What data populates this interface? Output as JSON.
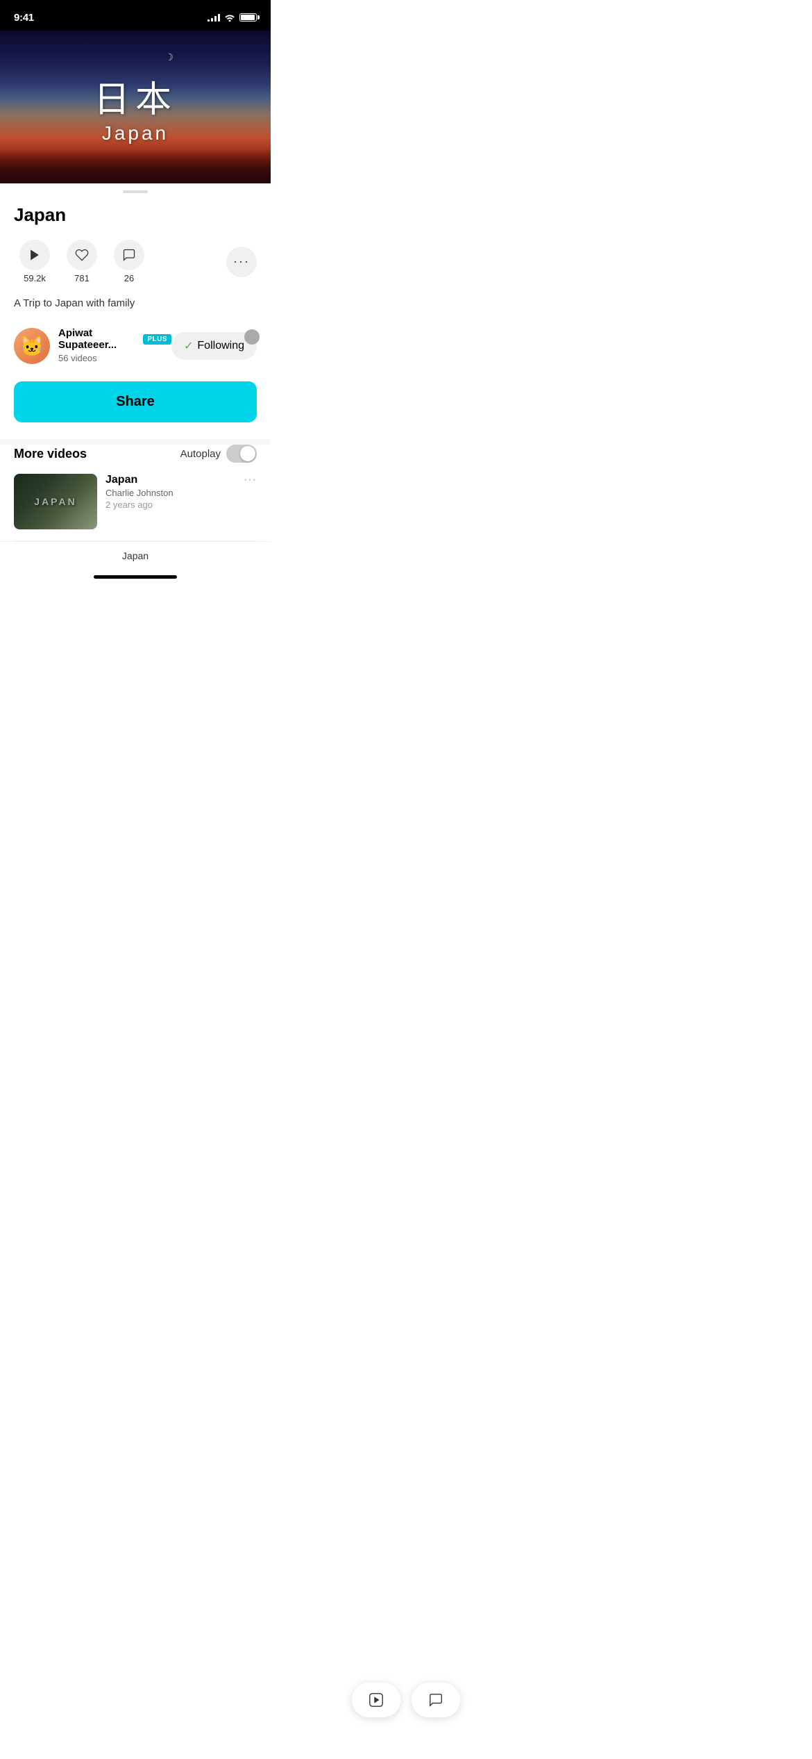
{
  "statusBar": {
    "time": "9:41"
  },
  "hero": {
    "kanji": "日本",
    "japan": "Japan"
  },
  "videoTitle": "Japan",
  "stats": {
    "plays": "59.2k",
    "likes": "781",
    "comments": "26"
  },
  "description": "A Trip to Japan with family",
  "creator": {
    "name": "Apiwat Supateeer...",
    "badge": "PLUS",
    "videos": "56 videos",
    "followingLabel": "Following"
  },
  "shareButton": "Share",
  "moreVideos": {
    "title": "More videos",
    "autoplayLabel": "Autoplay"
  },
  "videoList": [
    {
      "thumbnail": "JAPAN",
      "title": "Japan",
      "author": "Charlie Johnston",
      "meta": "2 years ago"
    }
  ],
  "bottomLabel": "Japan"
}
